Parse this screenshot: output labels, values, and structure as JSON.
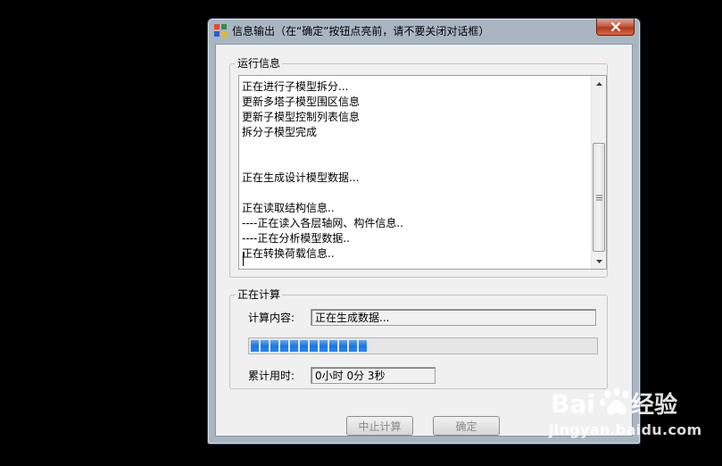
{
  "window": {
    "title": "信息输出（在“确定”按钮点亮前，请不要关闭对话框）"
  },
  "log_group": {
    "label": "运行信息",
    "lines": [
      "正在进行子模型拆分...",
      "更新多塔子模型围区信息",
      "更新子模型控制列表信息",
      "拆分子模型完成",
      "",
      "",
      "正在生成设计模型数据...",
      "",
      "正在读取结构信息..",
      "----正在读入各层轴网、构件信息..",
      "----正在分析模型数据..",
      "正在转换荷载信息.."
    ]
  },
  "calc_group": {
    "label": "正在计算",
    "content_label": "计算内容:",
    "content_value": "正在生成数据...",
    "progress_fraction": 0.34,
    "elapsed_label": "累计用时:",
    "elapsed_value": "0小时 0分 3秒"
  },
  "buttons": {
    "stop_label": "中止计算",
    "ok_label": "确定"
  },
  "watermark": {
    "text": "jingyan.baidu.com",
    "logo_text": "Baidu经验"
  },
  "colors": {
    "progress": "#1c76e0",
    "close_button": "#c65a3f"
  }
}
